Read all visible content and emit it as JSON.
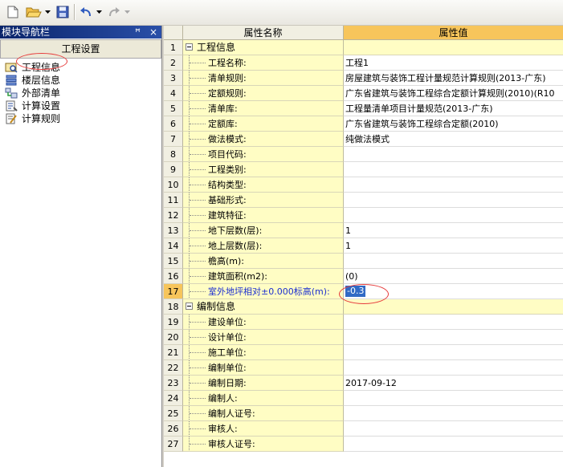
{
  "nav": {
    "title": "模块导航栏",
    "pin": "ꟸ",
    "close": "×",
    "tab": "工程设置",
    "items": [
      {
        "label": "工程信息"
      },
      {
        "label": "楼层信息"
      },
      {
        "label": "外部清单"
      },
      {
        "label": "计算设置"
      },
      {
        "label": "计算规则"
      }
    ]
  },
  "grid": {
    "headers": {
      "name": "属性名称",
      "value": "属性值"
    },
    "rows": [
      {
        "n": "1",
        "name": "工程信息",
        "value": ""
      },
      {
        "n": "2",
        "name": "工程名称:",
        "value": "工程1"
      },
      {
        "n": "3",
        "name": "清单规则:",
        "value": "房屋建筑与装饰工程计量规范计算规则(2013-广东)"
      },
      {
        "n": "4",
        "name": "定额规则:",
        "value": "广东省建筑与装饰工程综合定额计算规则(2010)(R10"
      },
      {
        "n": "5",
        "name": "清单库:",
        "value": "工程量清单项目计量规范(2013-广东)"
      },
      {
        "n": "6",
        "name": "定额库:",
        "value": "广东省建筑与装饰工程综合定额(2010)"
      },
      {
        "n": "7",
        "name": "做法模式:",
        "value": "纯做法模式"
      },
      {
        "n": "8",
        "name": "项目代码:",
        "value": ""
      },
      {
        "n": "9",
        "name": "工程类别:",
        "value": ""
      },
      {
        "n": "10",
        "name": "结构类型:",
        "value": ""
      },
      {
        "n": "11",
        "name": "基础形式:",
        "value": ""
      },
      {
        "n": "12",
        "name": "建筑特征:",
        "value": ""
      },
      {
        "n": "13",
        "name": "地下层数(层):",
        "value": "1"
      },
      {
        "n": "14",
        "name": "地上层数(层):",
        "value": "1"
      },
      {
        "n": "15",
        "name": "檐高(m):",
        "value": ""
      },
      {
        "n": "16",
        "name": "建筑面积(m2):",
        "value": "(0)"
      },
      {
        "n": "17",
        "name": "室外地坪相对±0.000标高(m):",
        "value": "-0.3"
      },
      {
        "n": "18",
        "name": "编制信息",
        "value": ""
      },
      {
        "n": "19",
        "name": "建设单位:",
        "value": ""
      },
      {
        "n": "20",
        "name": "设计单位:",
        "value": ""
      },
      {
        "n": "21",
        "name": "施工单位:",
        "value": ""
      },
      {
        "n": "22",
        "name": "编制单位:",
        "value": ""
      },
      {
        "n": "23",
        "name": "编制日期:",
        "value": "2017-09-12"
      },
      {
        "n": "24",
        "name": "编制人:",
        "value": ""
      },
      {
        "n": "25",
        "name": "编制人证号:",
        "value": ""
      },
      {
        "n": "26",
        "name": "审核人:",
        "value": ""
      },
      {
        "n": "27",
        "name": "审核人证号:",
        "value": ""
      }
    ]
  }
}
